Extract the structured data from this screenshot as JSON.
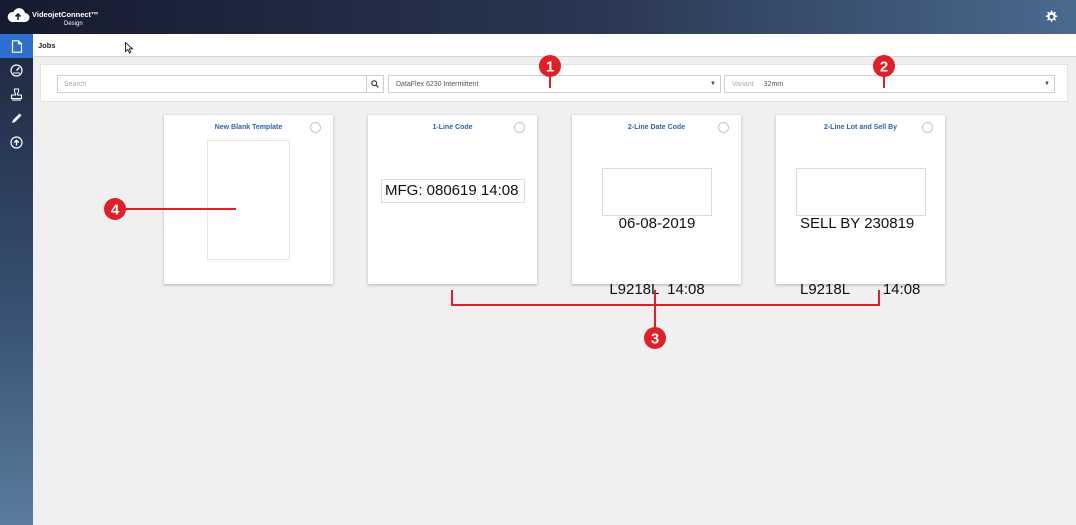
{
  "app": {
    "brand_name": "VideojetConnect™",
    "brand_sub": "Design"
  },
  "icons": {
    "logo": "cloud-icon",
    "settings": "gear-icon",
    "sidebar": [
      "document-icon",
      "gauge-icon",
      "stamp-icon",
      "pencil-icon",
      "upload-icon"
    ],
    "search": "search-icon"
  },
  "colors": {
    "accent": "#2d6fd0",
    "card_title": "#2f63b5",
    "annotation": "#e01f26"
  },
  "breadcrumb": {
    "label": "Jobs"
  },
  "filters": {
    "search_placeholder": "Search",
    "printer_model": "DataFlex 6230 Intermittent",
    "variant_label": "Variant",
    "variant_value": "32mm"
  },
  "templates": [
    {
      "title": "New Blank Template",
      "lines": []
    },
    {
      "title": "1-Line Code",
      "lines": [
        "MFG: 080619 14:08"
      ]
    },
    {
      "title": "2-Line Date Code",
      "lines": [
        "06-08-2019",
        "L9218L  14:08"
      ]
    },
    {
      "title": "2-Line Lot and Sell By",
      "lines": [
        "SELL BY 230819",
        "L9218L        14:08"
      ]
    }
  ],
  "annotations": [
    "1",
    "2",
    "3",
    "4"
  ]
}
